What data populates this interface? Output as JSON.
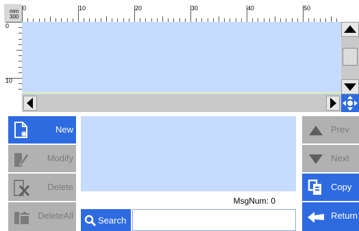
{
  "ruler": {
    "unit": "mm",
    "unit_value": "300",
    "top_labels": [
      "0",
      "10",
      "20",
      "30",
      "40",
      "50"
    ],
    "left_labels": [
      "0",
      "10"
    ]
  },
  "scroll": {
    "up_icon": "triangle-up-icon",
    "down_icon": "triangle-down-icon",
    "left_icon": "triangle-left-icon",
    "right_icon": "triangle-right-icon",
    "move_icon": "move-arrows-icon"
  },
  "left_buttons": [
    {
      "label": "New",
      "icon": "new-document-icon",
      "active": true
    },
    {
      "label": "Modify",
      "icon": "edit-document-icon",
      "active": false
    },
    {
      "label": "Delete",
      "icon": "delete-document-icon",
      "active": false
    },
    {
      "label": "DeleteAll",
      "icon": "delete-all-icon",
      "active": false
    }
  ],
  "right_buttons": [
    {
      "label": "Prev",
      "icon": "arrow-up-icon",
      "active": false
    },
    {
      "label": "Next",
      "icon": "arrow-down-icon",
      "active": false
    },
    {
      "label": "Copy",
      "icon": "copy-icon",
      "active": true
    },
    {
      "label": "Return",
      "icon": "return-arrow-icon",
      "active": true
    }
  ],
  "status": {
    "msgnum": "MsgNum: 0"
  },
  "search": {
    "label": "Search",
    "value": "",
    "placeholder": ""
  },
  "colors": {
    "accent": "#2e6be0",
    "canvas": "#c5dcff",
    "disabled": "#b1b1b1"
  }
}
